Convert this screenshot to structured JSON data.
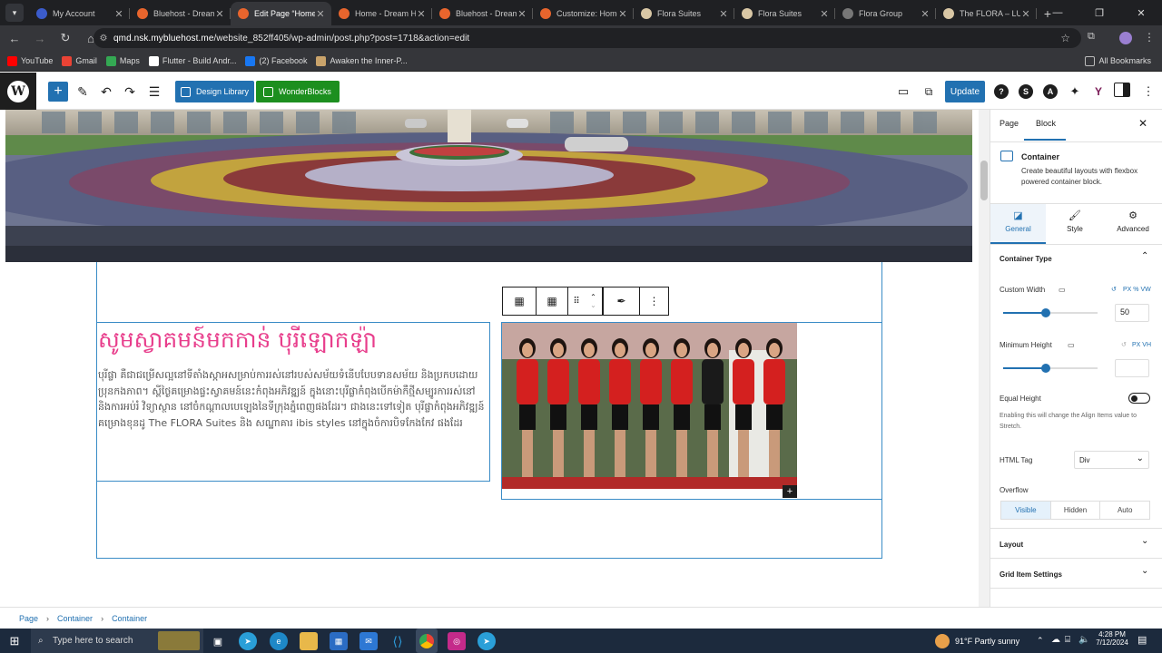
{
  "browser": {
    "tabs": [
      {
        "title": "My Account",
        "icon_color": "#3b5ccc",
        "icon": "grid-icon"
      },
      {
        "title": "Bluehost - Dream",
        "icon_color": "#e8652d",
        "icon": "bluehost-icon"
      },
      {
        "title": "Edit Page “Home”",
        "icon_color": "#e8652d",
        "icon": "bluehost-icon",
        "active": true
      },
      {
        "title": "Home - Dream Ho",
        "icon_color": "#e8652d",
        "icon": "bluehost-icon"
      },
      {
        "title": "Bluehost - Dream",
        "icon_color": "#e8652d",
        "icon": "bluehost-icon"
      },
      {
        "title": "Customize: Home",
        "icon_color": "#e8652d",
        "icon": "bluehost-icon"
      },
      {
        "title": "Flora Suites",
        "icon_color": "#d9c7a5",
        "icon": "flora-icon"
      },
      {
        "title": "Flora Suites",
        "icon_color": "#d9c7a5",
        "icon": "flora-icon"
      },
      {
        "title": "Flora Group",
        "icon_color": "#777777",
        "icon": "globe-icon"
      },
      {
        "title": "The FLORA – LUX",
        "icon_color": "#d9c7a5",
        "icon": "flora-icon"
      }
    ],
    "url_host": "qmd.nsk.mybluehost.me",
    "url_path": "/website_852ff405/wp-admin/post.php?post=1718&action=edit",
    "bookmarks": [
      {
        "label": "YouTube",
        "color": "#ff0000"
      },
      {
        "label": "Gmail",
        "color": "#ea4335"
      },
      {
        "label": "Maps",
        "color": "#34a853"
      },
      {
        "label": "Flutter - Build Andr...",
        "color": "#ffffff"
      },
      {
        "label": "(2) Facebook",
        "color": "#1877f2"
      },
      {
        "label": "Awaken the Inner-P...",
        "color": "#c9a36b"
      }
    ],
    "all_bookmarks": "All Bookmarks"
  },
  "toolbar": {
    "design_library": "Design Library",
    "wonderblocks": "WonderBlocks",
    "update": "Update"
  },
  "content": {
    "heading": "សូមស្វាគមន៍មកកាន់ បុរីឡោកឡ៉ា",
    "paragraph": "បុរីផ្លា គឺជាជម្រើសល្អនៅទីតាំងស្កាអសម្រាប់ការរស់នៅរបស់សម័យទំនើបបែបទានសម័យ និងប្រកបដោយប្រុនកងភាព។ ស្ពីថ្ងៃគម្រោងផ្ទះស្វាគមន៍នេះកំពុងអភិវឌ្ឍន៍ ក្នុងនោះបុរីផ្លាកំពុងបើកម៉ាកឺថ្មីសម្បូរការរស់នៅ និងការអប់រំ វិទ្យាស្ថាន នៅចំកណ្ដាលបេឡេងនៃទីក្រុងភ្នំពេញផងដែរ។ ជាងនេះទៅទៀត បុរីផ្លាកំពុងអភិវឌ្ឍន៍ គម្រោងខុនដូ The FLORA Suites និង សណ្ឋាគារ ibis styles នៅក្នុងចំការបិទកែងកែវ ផងដែរ"
  },
  "sidebar": {
    "tab_page": "Page",
    "tab_block": "Block",
    "block_name": "Container",
    "block_desc": "Create beautiful layouts with flexbox powered container block.",
    "sub_general": "General",
    "sub_style": "Style",
    "sub_advanced": "Advanced",
    "container_type": "Container Type",
    "custom_width": "Custom Width",
    "custom_width_units": "PX  %  VW",
    "custom_width_value": "50",
    "custom_width_fraction": 0.45,
    "min_height": "Minimum Height",
    "min_height_units": "PX  VH",
    "min_height_fraction": 0.45,
    "equal_height": "Equal Height",
    "equal_height_desc": "Enabling this will change the Align Items value to Stretch.",
    "html_tag": "HTML Tag",
    "html_tag_value": "Div",
    "overflow": "Overflow",
    "overflow_options": [
      "Visible",
      "Hidden",
      "Auto"
    ],
    "layout": "Layout",
    "grid_item": "Grid Item Settings"
  },
  "breadcrumb": [
    "Page",
    "Container",
    "Container"
  ],
  "taskbar": {
    "search_placeholder": "Type here to search",
    "weather": "91°F  Partly sunny",
    "time": "4:28 PM",
    "date": "7/12/2024"
  }
}
